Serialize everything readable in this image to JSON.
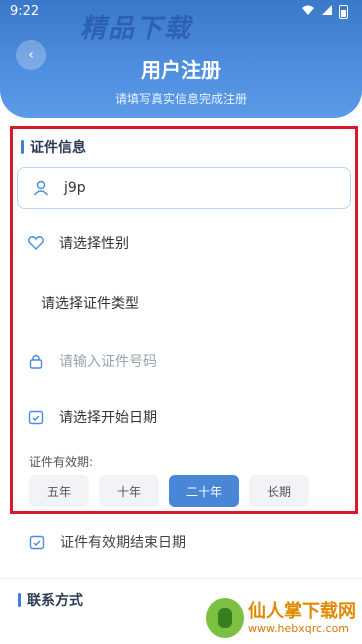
{
  "status_bar": {
    "time": "9:22"
  },
  "watermark_top": "精品下载",
  "header": {
    "title": "用户注册",
    "subtitle": "请填写真实信息完成注册"
  },
  "section": {
    "title": "证件信息",
    "name_value": "j9p",
    "gender_label": "请选择性别",
    "id_type_label": "请选择证件类型",
    "id_number_placeholder": "请输入证件号码",
    "start_date_label": "请选择开始日期",
    "validity_label": "证件有效期:",
    "validity_options": [
      "五年",
      "十年",
      "二十年",
      "长期"
    ],
    "validity_selected": "二十年"
  },
  "end_date_label": "证件有效期结束日期",
  "next_section_title": "联系方式",
  "watermark_bottom": {
    "name": "仙人掌下载网",
    "url": "www.hebxqrc.com"
  },
  "colors": {
    "primary": "#4a86d8",
    "highlight_border": "#d6192d"
  },
  "icons": [
    "user-icon",
    "heart-icon",
    "lock-icon",
    "calendar-icon",
    "calendar-icon",
    "back-arrow-icon"
  ]
}
